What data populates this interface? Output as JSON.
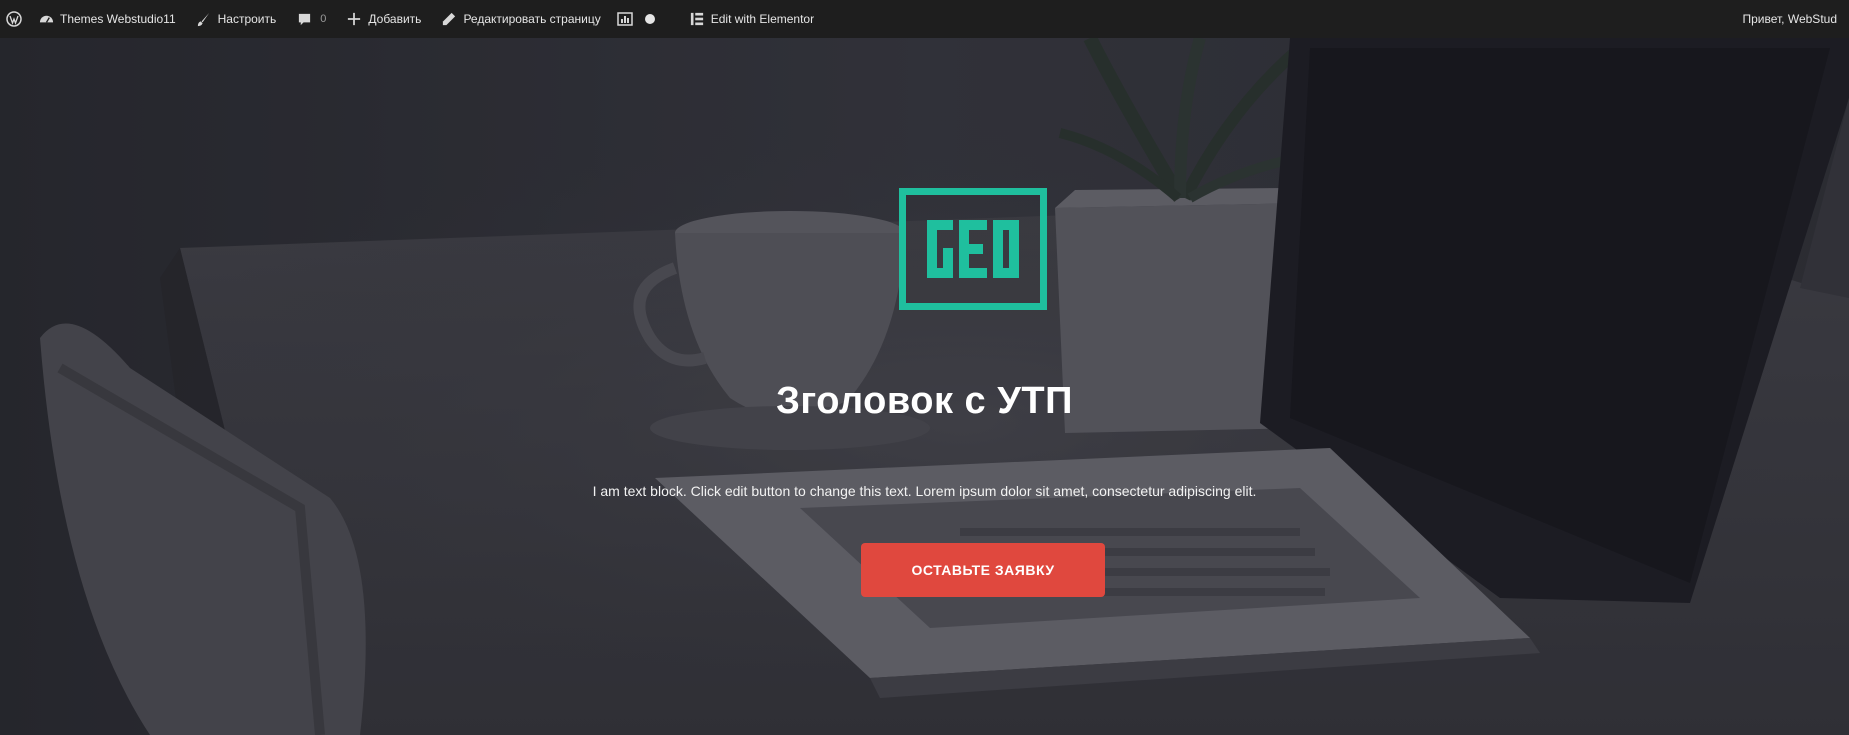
{
  "adminbar": {
    "site_name": "Themes Webstudio11",
    "customize": "Настроить",
    "comments_count": "0",
    "add_new": "Добавить",
    "edit_page": "Редактировать страницу",
    "elementor": "Edit with Elementor",
    "greeting": "Привет, WebStud"
  },
  "hero": {
    "logo_text": "GEO",
    "title": "Зголовок с УТП",
    "text": "I am text block. Click edit button to change this text. Lorem ipsum dolor sit amet, consectetur adipiscing elit.",
    "cta_label": "ОСТАВЬТЕ ЗАЯВКУ"
  },
  "colors": {
    "accent": "#1fbf9e",
    "cta": "#e0483e",
    "adminbar": "#1e1e1e"
  },
  "icons": [
    "wordpress-icon",
    "dashboard-icon",
    "brush-icon",
    "comment-icon",
    "plus-icon",
    "pencil-icon",
    "stats-icon",
    "status-dot-icon",
    "elementor-icon"
  ]
}
